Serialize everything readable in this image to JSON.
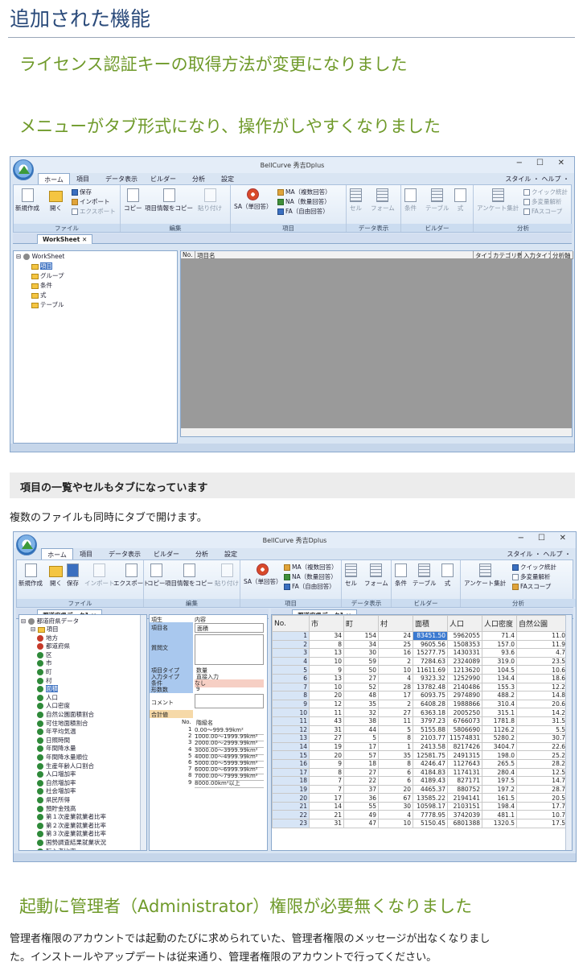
{
  "page": {
    "heading": "追加された機能",
    "section1": "ライセンス認証キーの取得方法が変更になりました",
    "section2": "メニューがタブ形式になり、操作がしやすくなりました",
    "gray_heading": "項目の一覧やセルもタブになっています",
    "para1": "複数のファイルも同時にタブで開けます。",
    "section3": "起動に管理者（Administrator）権限が必要無くなりました",
    "para2_line1": "管理者権限のアカウントでは起動のたびに求められていた、管理者権限のメッセージが出なくなりまし",
    "para2_line2": "た。インストールやアップデートは従来通り、管理者権限のアカウントで行ってください。"
  },
  "app": {
    "title": "BellCurve 秀吉Dplus",
    "window_controls": [
      "−",
      "☐",
      "✕"
    ],
    "help_right": "スタイル ・ ヘルプ ・",
    "tabs": [
      "ホーム",
      "項目",
      "データ表示",
      "ビルダー",
      "分析",
      "設定"
    ],
    "groups": {
      "file": "ファイル",
      "edit": "編集",
      "item": "項目",
      "data": "データ表示",
      "builder": "ビルダー",
      "analysis": "分析"
    },
    "buttons": {
      "new": "新規作成",
      "open": "開く",
      "save": "保存",
      "import": "インポート",
      "export": "エクスポート",
      "copy": "コピー",
      "copy_item": "項目情報をコピー",
      "paste": "貼り付け",
      "sa": "SA（単回答）",
      "ma": "MA（複数回答）",
      "na": "NA（数量回答）",
      "fa": "FA（自由回答）",
      "cell": "セル",
      "form": "フォーム",
      "cond": "条件",
      "table": "テーブル",
      "formula": "式",
      "survey": "アンケート集計",
      "quick": "クイック統計",
      "multivar": "多変量解析",
      "fa_scope": "FAスコープ"
    }
  },
  "shot1": {
    "doctab": "WorkSheet",
    "tree": [
      "WorkSheet",
      "項目",
      "グループ",
      "条件",
      "式",
      "テーブル"
    ],
    "grid_headers": [
      "No.",
      "項目名",
      "タイプ",
      "カテゴリ数",
      "入力タイプ",
      "分析軸"
    ]
  },
  "shot2": {
    "doctab1": "都道府県データ1",
    "doctab2": "都道府県データ1",
    "tree_root": "都道府県データ",
    "tree_items": [
      "項目",
      "地方",
      "都道府県",
      "区",
      "市",
      "町",
      "村",
      "面積",
      "人口",
      "人口密度",
      "自然公園面積割合",
      "可住地面積割合",
      "年平均気温",
      "日照時間",
      "年間降水量",
      "年間降水量順位",
      "生産年齢人口割合",
      "人口増加率",
      "自然増加率",
      "社会増加率",
      "県民所得",
      "預貯金残高",
      "第１次産業就業者比率",
      "第２次産業就業者比率",
      "第３次産業就業者比率",
      "国勢調査結果就業状況",
      "転入者比率"
    ],
    "props": {
      "h_k": "項生",
      "h_v": "内容",
      "name_k": "項目名",
      "name_v": "面積",
      "q_k": "質問文",
      "type_k": "項目タイプ",
      "type_v": "数量",
      "input_k": "入力タイプ",
      "input_v": "直接入力",
      "cond_k": "条件",
      "cond_v": "なし",
      "cats_k": "形数数",
      "cats_v": "9",
      "comment_k": "コメント",
      "agg_k": "合計値",
      "cat_head_no": "No.",
      "cat_head": "階級名",
      "cats": [
        "0.00〜999.99km²",
        "1000.00〜1999.99km²",
        "2000.00〜2999.99km²",
        "3000.00〜3999.99km²",
        "4000.00〜4999.99km²",
        "5000.00〜5999.99km²",
        "6000.00〜6999.99km²",
        "7000.00〜7999.99km²",
        "8000.00km²以上"
      ]
    },
    "table": {
      "headers": [
        "No.",
        "市",
        "町",
        "村",
        "面積",
        "人口",
        "人口密度",
        "自然公園"
      ],
      "rows": [
        [
          "1",
          "34",
          "154",
          "24",
          "83451.50",
          "5962055",
          "71.4",
          "11.0"
        ],
        [
          "2",
          "8",
          "34",
          "25",
          "9605.56",
          "1508353",
          "157.0",
          "11.9"
        ],
        [
          "3",
          "13",
          "30",
          "16",
          "15277.75",
          "1430331",
          "93.6",
          "4.7"
        ],
        [
          "4",
          "10",
          "59",
          "2",
          "7284.63",
          "2324089",
          "319.0",
          "23.5"
        ],
        [
          "5",
          "9",
          "50",
          "10",
          "11611.69",
          "1213620",
          "104.5",
          "10.6"
        ],
        [
          "6",
          "13",
          "27",
          "4",
          "9323.32",
          "1252990",
          "134.4",
          "18.6"
        ],
        [
          "7",
          "10",
          "52",
          "28",
          "13782.48",
          "2140486",
          "155.3",
          "12.2"
        ],
        [
          "8",
          "20",
          "48",
          "17",
          "6093.75",
          "2974890",
          "488.2",
          "14.8"
        ],
        [
          "9",
          "12",
          "35",
          "2",
          "6408.28",
          "1988866",
          "310.4",
          "20.6"
        ],
        [
          "10",
          "11",
          "32",
          "27",
          "6363.18",
          "2005250",
          "315.1",
          "14.2"
        ],
        [
          "11",
          "43",
          "38",
          "11",
          "3797.23",
          "6766073",
          "1781.8",
          "31.5"
        ],
        [
          "12",
          "31",
          "44",
          "5",
          "5155.88",
          "5806690",
          "1126.2",
          "5.5"
        ],
        [
          "13",
          "27",
          "5",
          "8",
          "2103.77",
          "11574831",
          "5280.2",
          "30.7"
        ],
        [
          "14",
          "19",
          "17",
          "1",
          "2413.58",
          "8217426",
          "3404.7",
          "22.6"
        ],
        [
          "15",
          "20",
          "57",
          "35",
          "12581.75",
          "2491315",
          "198.0",
          "25.2"
        ],
        [
          "16",
          "9",
          "18",
          "8",
          "4246.47",
          "1127643",
          "265.5",
          "28.2"
        ],
        [
          "17",
          "8",
          "27",
          "6",
          "4184.83",
          "1174131",
          "280.4",
          "12.5"
        ],
        [
          "18",
          "7",
          "22",
          "6",
          "4189.43",
          "827171",
          "197.5",
          "14.7"
        ],
        [
          "19",
          "7",
          "37",
          "20",
          "4465.37",
          "880752",
          "197.2",
          "28.7"
        ],
        [
          "20",
          "17",
          "36",
          "67",
          "13585.22",
          "2194141",
          "161.5",
          "20.5"
        ],
        [
          "21",
          "14",
          "55",
          "30",
          "10598.17",
          "2103151",
          "198.4",
          "17.7"
        ],
        [
          "22",
          "21",
          "49",
          "4",
          "7778.95",
          "3742039",
          "481.1",
          "10.7"
        ],
        [
          "23",
          "31",
          "47",
          "10",
          "5150.45",
          "6801388",
          "1320.5",
          "17.5"
        ]
      ]
    }
  }
}
